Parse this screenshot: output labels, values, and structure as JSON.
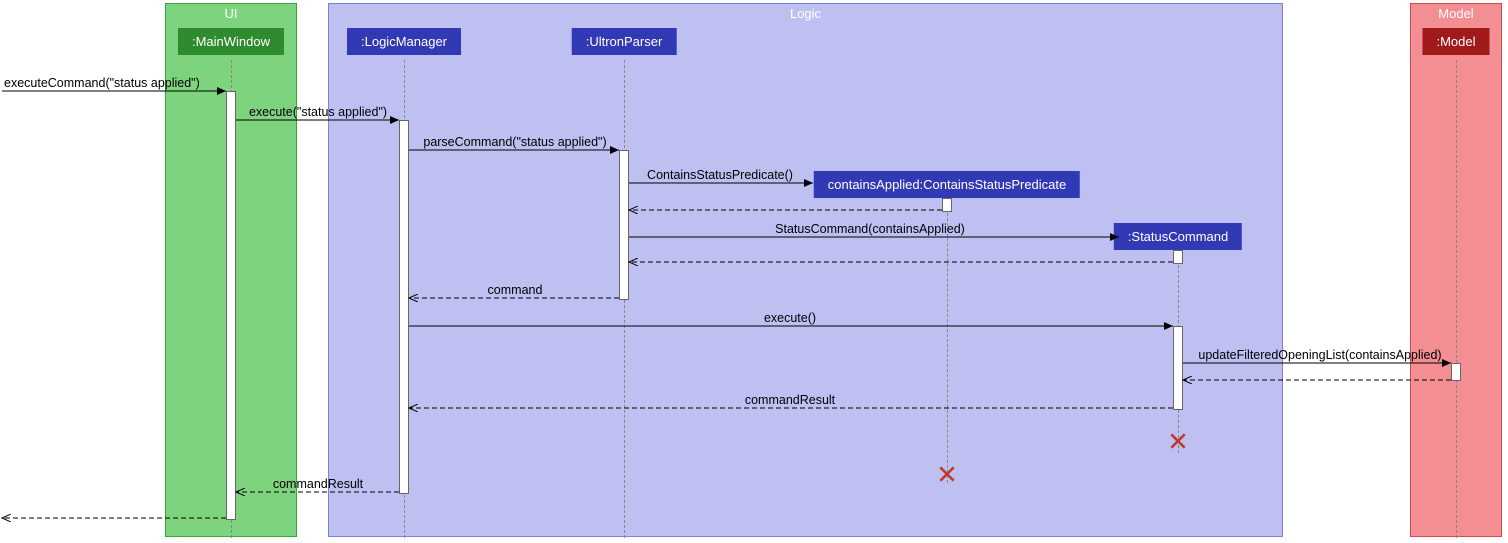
{
  "boundaries": {
    "ui": {
      "label": "UI",
      "color_fill": "#7ed37e",
      "color_stroke": "#3aa63a"
    },
    "logic": {
      "label": "Logic",
      "color_fill": "#bfc0f2",
      "color_stroke": "#7e80d8"
    },
    "model": {
      "label": "Model",
      "color_fill": "#f38e93",
      "color_stroke": "#d64a52"
    }
  },
  "participants": {
    "mainwindow": {
      "label": ":MainWindow",
      "color": "#2e8b2e"
    },
    "logicmanager": {
      "label": ":LogicManager",
      "color": "#3239b5"
    },
    "ultronparser": {
      "label": ":UltronParser",
      "color": "#3239b5"
    },
    "predicate": {
      "label": "containsApplied:ContainsStatusPredicate",
      "color": "#3239b5"
    },
    "statuscommand": {
      "label": ":StatusCommand",
      "color": "#3239b5"
    },
    "model": {
      "label": ":Model",
      "color": "#a01a1a"
    }
  },
  "messages": {
    "m1": "executeCommand(\"status applied\")",
    "m2": "execute(\"status applied\")",
    "m3": "parseCommand(\"status applied\")",
    "m4": "ContainsStatusPredicate()",
    "m5": "StatusCommand(containsApplied)",
    "m6": "command",
    "m7": "execute()",
    "m8": "updateFilteredOpeningList(containsApplied)",
    "m9": "commandResult",
    "m10": "commandResult"
  },
  "chart_data": {
    "type": "table",
    "description": "UML sequence diagram",
    "participants": [
      {
        "name": ":MainWindow",
        "boundary": "UI"
      },
      {
        "name": ":LogicManager",
        "boundary": "Logic"
      },
      {
        "name": ":UltronParser",
        "boundary": "Logic"
      },
      {
        "name": "containsApplied:ContainsStatusPredicate",
        "boundary": "Logic",
        "created": true,
        "destroyed": true
      },
      {
        "name": ":StatusCommand",
        "boundary": "Logic",
        "created": true,
        "destroyed": true
      },
      {
        "name": ":Model",
        "boundary": "Model"
      }
    ],
    "messages": [
      {
        "from": "external",
        "to": ":MainWindow",
        "label": "executeCommand(\"status applied\")",
        "type": "call"
      },
      {
        "from": ":MainWindow",
        "to": ":LogicManager",
        "label": "execute(\"status applied\")",
        "type": "call"
      },
      {
        "from": ":LogicManager",
        "to": ":UltronParser",
        "label": "parseCommand(\"status applied\")",
        "type": "call"
      },
      {
        "from": ":UltronParser",
        "to": "containsApplied:ContainsStatusPredicate",
        "label": "ContainsStatusPredicate()",
        "type": "create"
      },
      {
        "from": "containsApplied:ContainsStatusPredicate",
        "to": ":UltronParser",
        "label": "",
        "type": "return"
      },
      {
        "from": ":UltronParser",
        "to": ":StatusCommand",
        "label": "StatusCommand(containsApplied)",
        "type": "create"
      },
      {
        "from": ":StatusCommand",
        "to": ":UltronParser",
        "label": "",
        "type": "return"
      },
      {
        "from": ":UltronParser",
        "to": ":LogicManager",
        "label": "command",
        "type": "return"
      },
      {
        "from": ":LogicManager",
        "to": ":StatusCommand",
        "label": "execute()",
        "type": "call"
      },
      {
        "from": ":StatusCommand",
        "to": ":Model",
        "label": "updateFilteredOpeningList(containsApplied)",
        "type": "call"
      },
      {
        "from": ":Model",
        "to": ":StatusCommand",
        "label": "",
        "type": "return"
      },
      {
        "from": ":StatusCommand",
        "to": ":LogicManager",
        "label": "commandResult",
        "type": "return"
      },
      {
        "from": ":LogicManager",
        "to": ":MainWindow",
        "label": "commandResult",
        "type": "return"
      },
      {
        "from": ":MainWindow",
        "to": "external",
        "label": "",
        "type": "return"
      }
    ]
  }
}
